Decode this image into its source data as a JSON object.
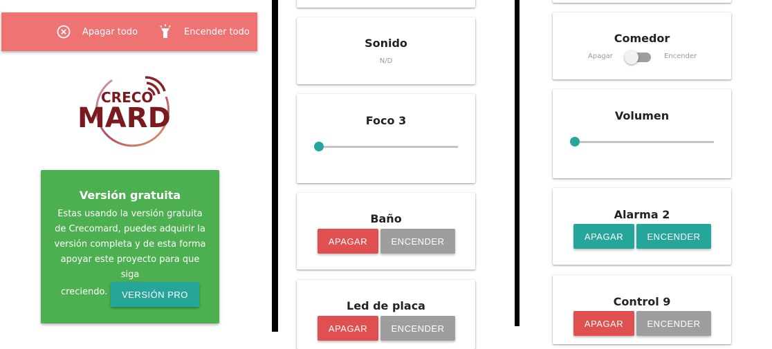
{
  "toolbar": {
    "off_all_label": "Apagar todo",
    "on_all_label": "Encender todo",
    "bar_color": "#f07373"
  },
  "logo": {
    "line1": "CRECO",
    "line2": "MARD"
  },
  "promo": {
    "title": "Versión gratuita",
    "body": "Estas usando la versión gratuita de Crecomard, puedes adquirir la versión completa y de esta forma apoyar este proyecto para que siga",
    "body_last": "creciendo.",
    "button_label": "VERSIÓN PRO",
    "color": "#4caf50"
  },
  "panel2": {
    "sonido": {
      "title": "Sonido",
      "value": "N/D"
    },
    "foco3": {
      "title": "Foco 3",
      "level": 0
    },
    "bano": {
      "title": "Baño",
      "off_label": "APAGAR",
      "on_label": "ENCENDER"
    },
    "led": {
      "title": "Led de placa",
      "off_label": "APAGAR",
      "on_label": "ENCENDER"
    }
  },
  "panel3": {
    "comedor": {
      "title": "Comedor",
      "off_label": "Apagar",
      "on_label": "Encender",
      "state": "off"
    },
    "volumen": {
      "title": "Volumen",
      "level": 0
    },
    "alarma2": {
      "title": "Alarma 2",
      "off_label": "APAGAR",
      "on_label": "ENCENDER"
    },
    "control9": {
      "title": "Control 9",
      "off_label": "APAGAR",
      "on_label": "ENCENDER"
    }
  },
  "colors": {
    "accent_teal": "#26a69a",
    "danger_red": "#e05050",
    "neutral_grey": "#9e9e9e",
    "brand_dark_red": "#7a1a1e"
  }
}
